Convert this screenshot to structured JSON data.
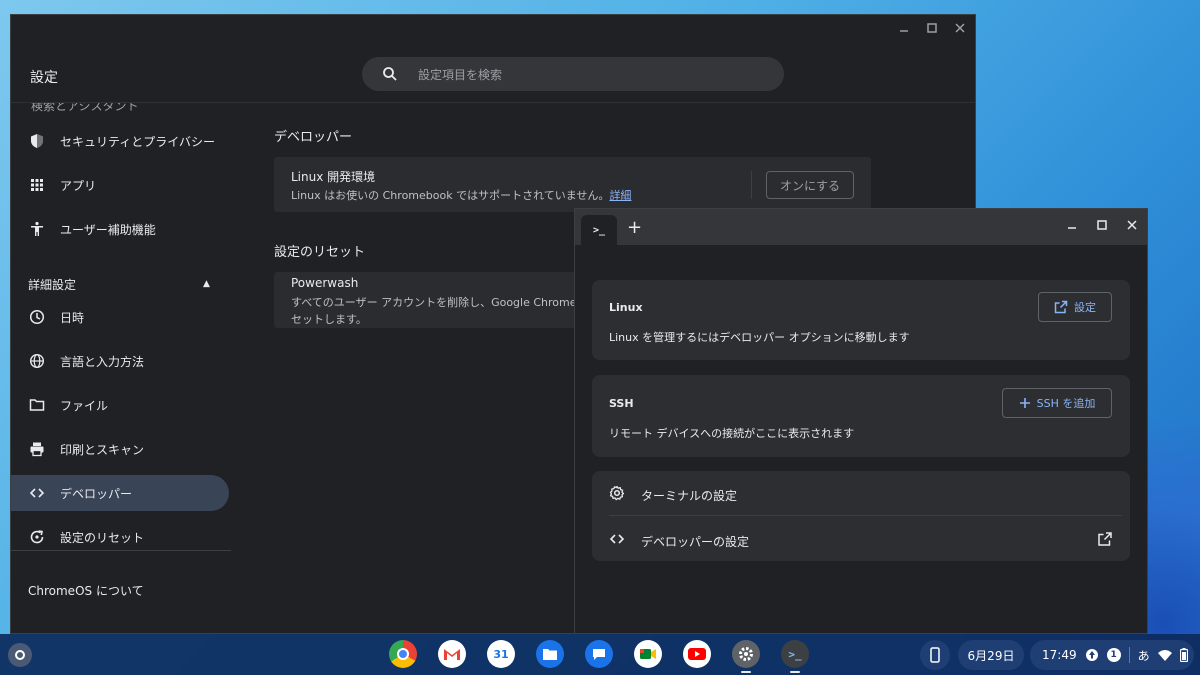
{
  "settings": {
    "title": "設定",
    "search_placeholder": "設定項目を検索",
    "sidebar": {
      "cut_off_item": "検索とアシスタント",
      "items": [
        {
          "label": "セキュリティとプライバシー",
          "icon": "shield-icon"
        },
        {
          "label": "アプリ",
          "icon": "apps-grid-icon"
        },
        {
          "label": "ユーザー補助機能",
          "icon": "accessibility-icon"
        }
      ],
      "advanced_section": "詳細設定",
      "advanced_items": [
        {
          "label": "日時",
          "icon": "clock-icon"
        },
        {
          "label": "言語と入力方法",
          "icon": "globe-icon"
        },
        {
          "label": "ファイル",
          "icon": "folder-icon"
        },
        {
          "label": "印刷とスキャン",
          "icon": "printer-icon"
        },
        {
          "label": "デベロッパー",
          "icon": "code-icon",
          "active": true
        },
        {
          "label": "設定のリセット",
          "icon": "reset-icon"
        }
      ],
      "about": "ChromeOS について"
    },
    "developer": {
      "heading": "デベロッパー",
      "linux_title": "Linux 開発環境",
      "linux_sub": "Linux はお使いの Chromebook ではサポートされていません。",
      "linux_link": "詳細",
      "turn_on_button": "オンにする"
    },
    "reset": {
      "heading": "設定のリセット",
      "powerwash_title": "Powerwash",
      "powerwash_sub_line1": "すべてのユーザー アカウントを削除し、Google Chrome",
      "powerwash_sub_line2": "セットします。"
    }
  },
  "terminal": {
    "tab_label": ">_",
    "new_tab": "+",
    "linux_card": {
      "title": "Linux",
      "sub": "Linux を管理するにはデベロッパー オプションに移動します",
      "button": "設定"
    },
    "ssh_card": {
      "title": "SSH",
      "sub": "リモート デバイスへの接続がここに表示されます",
      "button": "SSH を追加"
    },
    "rows": [
      {
        "label": "ターミナルの設定",
        "icon": "gear-icon"
      },
      {
        "label": "デベロッパーの設定",
        "icon": "code-icon"
      }
    ]
  },
  "shelf": {
    "apps": [
      "Chrome",
      "Gmail",
      "Calendar",
      "Files",
      "Messages",
      "Meet",
      "YouTube",
      "Settings",
      "Terminal"
    ],
    "calendar_day": "31",
    "date": "6月29日",
    "time": "17:49",
    "notification_count": "1",
    "ime": "あ"
  },
  "colors": {
    "accent": "#8ab4f8",
    "active_nav": "#394457",
    "window_bg": "#202124"
  }
}
